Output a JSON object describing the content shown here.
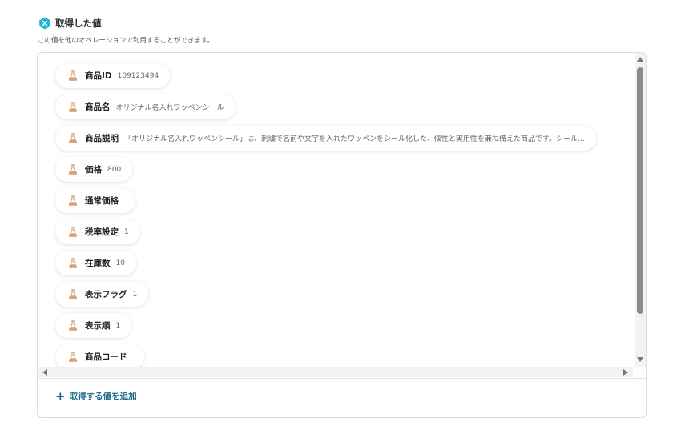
{
  "section": {
    "title": "取得した値",
    "description": "この値を他のオペレーションで利用することができます。",
    "icon": "hexagon-x-icon",
    "icon_color": "#1fb6d5"
  },
  "fields": [
    {
      "label": "商品ID",
      "value": "109123494"
    },
    {
      "label": "商品名",
      "value": "オリジナル名入れワッペンシール"
    },
    {
      "label": "商品説明",
      "value": "「オリジナル名入れワッペンシール」は、刺繍で名前や文字を入れたワッペンをシール化した、個性と実用性を兼ね備えた商品です。シール..."
    },
    {
      "label": "価格",
      "value": "800"
    },
    {
      "label": "通常価格",
      "value": ""
    },
    {
      "label": "税率設定",
      "value": "1"
    },
    {
      "label": "在庫数",
      "value": "10"
    },
    {
      "label": "表示フラグ",
      "value": "1"
    },
    {
      "label": "表示順",
      "value": "1"
    },
    {
      "label": "商品コード",
      "value": ""
    }
  ],
  "field_icon": "flask-icon",
  "add_button": {
    "label": "取得する値を追加",
    "icon": "plus-icon",
    "color": "#1f6a8a"
  }
}
